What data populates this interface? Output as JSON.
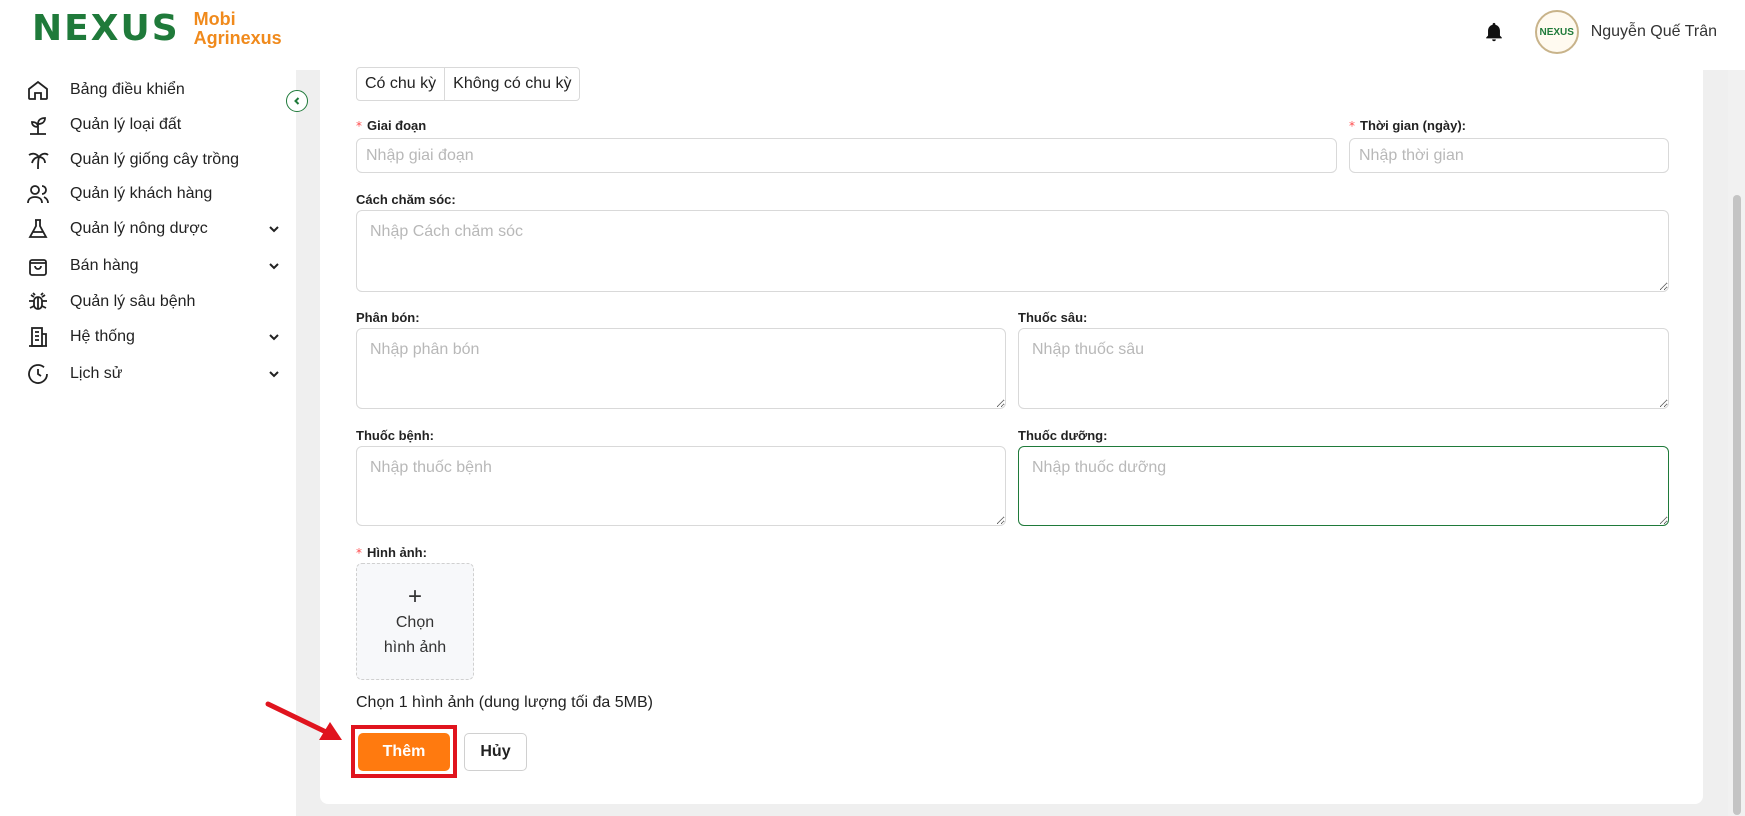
{
  "header": {
    "logo_mark": "NEXUS",
    "logo_line1": "Mobi",
    "logo_line2": "Agrinexus",
    "avatar_text": "NEXUS",
    "username": "Nguyễn Quế Trân"
  },
  "sidebar": {
    "items": [
      {
        "label": "Bảng điều khiển",
        "icon": "home-icon"
      },
      {
        "label": "Quản lý loại đất",
        "icon": "plant-icon"
      },
      {
        "label": "Quản lý giống cây trồng",
        "icon": "palm-tree-icon"
      },
      {
        "label": "Quản lý khách hàng",
        "icon": "users-icon"
      },
      {
        "label": "Quản lý nông dược",
        "icon": "flask-icon"
      },
      {
        "label": "Bán hàng",
        "icon": "shopping-bag-icon"
      },
      {
        "label": "Quản lý sâu bệnh",
        "icon": "bug-icon"
      },
      {
        "label": "Hệ thống",
        "icon": "building-icon"
      },
      {
        "label": "Lịch sử",
        "icon": "clock-icon"
      }
    ]
  },
  "form": {
    "cycle_options": [
      "Có chu kỳ",
      "Không có chu kỳ"
    ],
    "stage_label": "Giai đoạn",
    "stage_placeholder": "Nhập giai đoạn",
    "time_label": "Thời gian (ngày):",
    "time_placeholder": "Nhập thời gian",
    "care_label": "Cách chăm sóc:",
    "care_placeholder": "Nhập Cách chăm sóc",
    "fertilizer_label": "Phân bón:",
    "fertilizer_placeholder": "Nhập phân bón",
    "insecticide_label": "Thuốc sâu:",
    "insecticide_placeholder": "Nhập thuốc sâu",
    "disease_med_label": "Thuốc bệnh:",
    "disease_med_placeholder": "Nhập thuốc bệnh",
    "nutrient_label": "Thuốc dưỡng:",
    "nutrient_placeholder": "Nhập thuốc dưỡng",
    "image_label": "Hình ảnh:",
    "upload_plus": "+",
    "upload_line1": "Chọn",
    "upload_line2": "hình ảnh",
    "image_hint": "Chọn 1 hình ảnh (dung lượng tối đa 5MB)",
    "add_button": "Thêm",
    "cancel_button": "Hủy"
  },
  "colors": {
    "brand_green": "#1f7a3a",
    "accent_orange": "#ff7a0f",
    "highlight_red": "#e0141e"
  }
}
